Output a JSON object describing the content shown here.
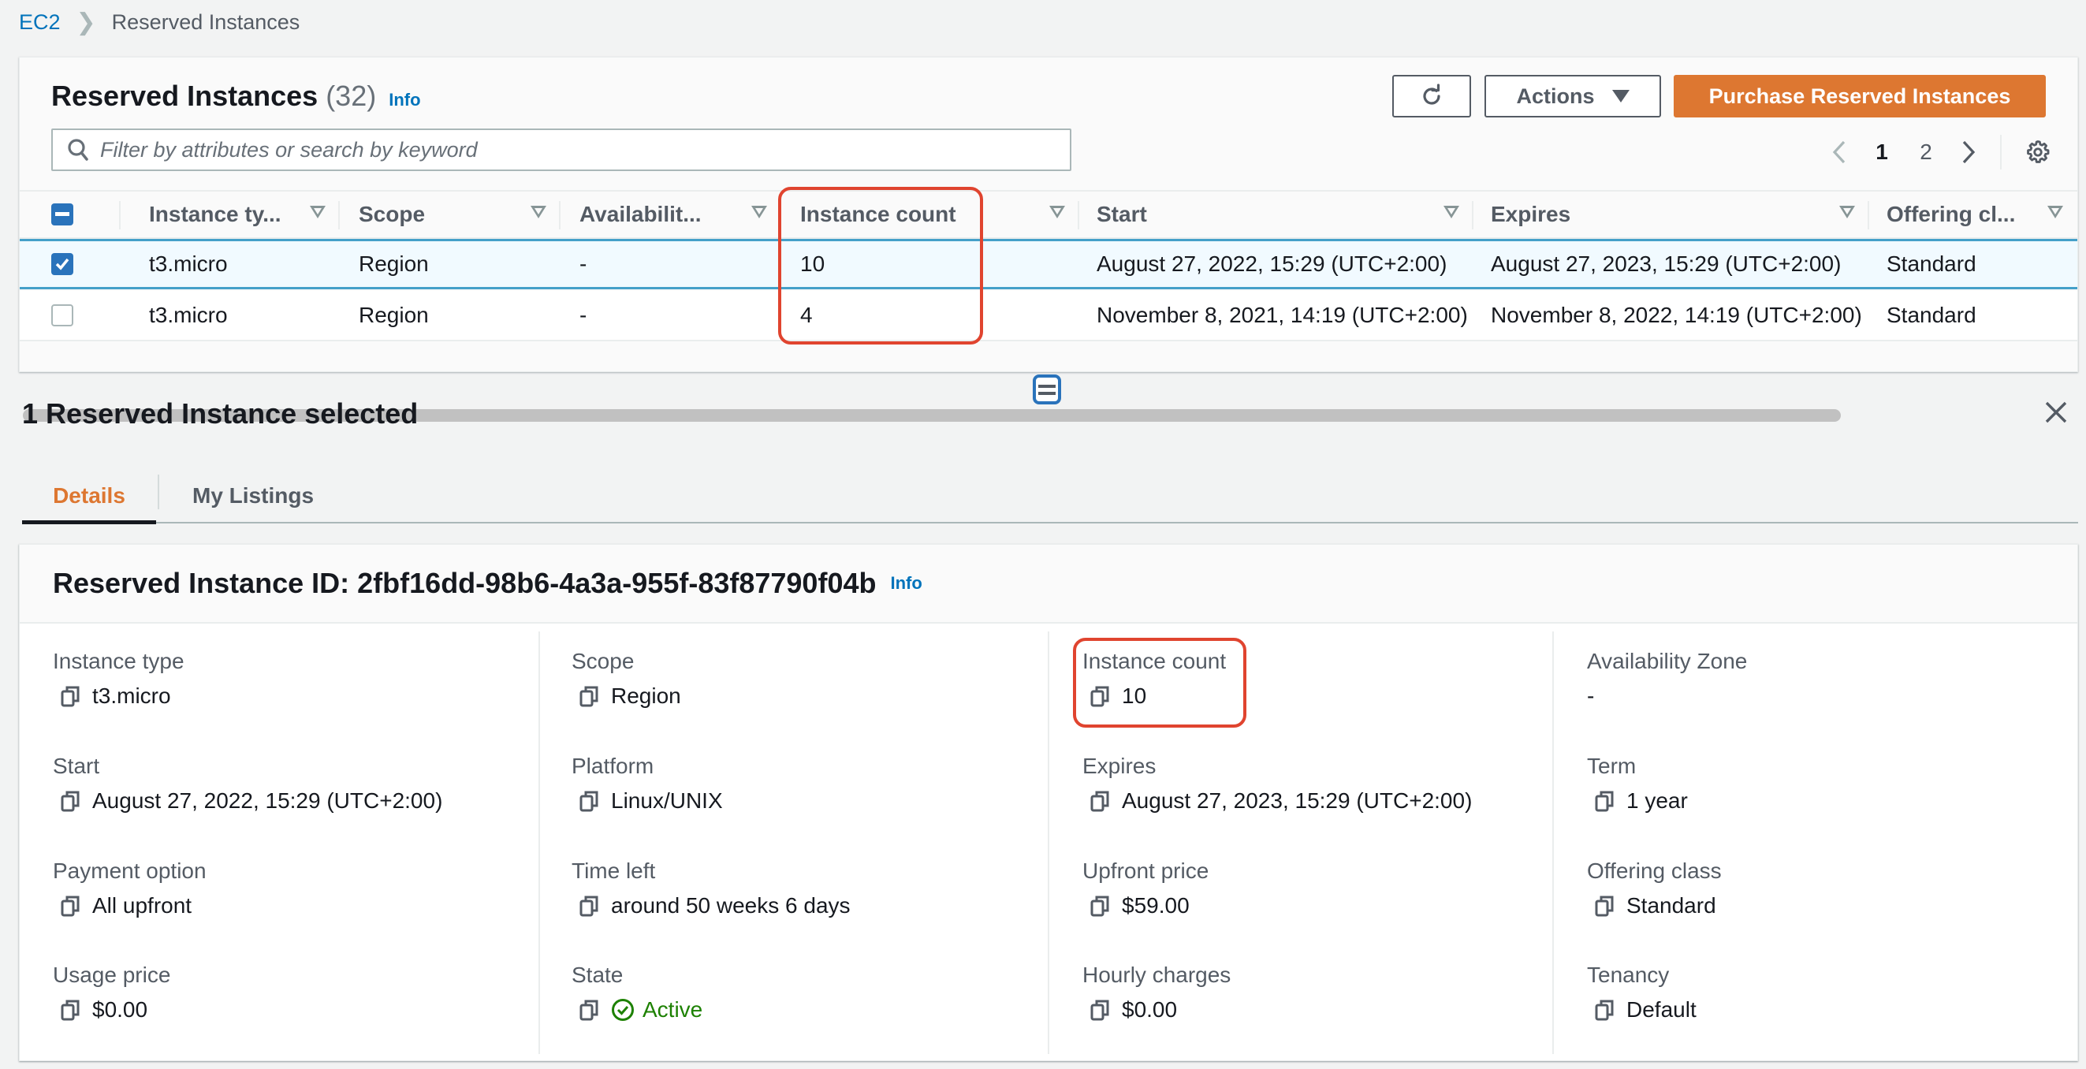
{
  "breadcrumb": {
    "root": "EC2",
    "current": "Reserved Instances"
  },
  "header": {
    "title": "Reserved Instances",
    "count": "(32)",
    "info": "Info",
    "refresh_icon": "refresh-icon",
    "actions_label": "Actions",
    "primary_label": "Purchase Reserved Instances"
  },
  "search": {
    "placeholder": "Filter by attributes or search by keyword",
    "value": ""
  },
  "pagination": {
    "pages": [
      "1",
      "2"
    ],
    "current": "1"
  },
  "table": {
    "columns": [
      "Instance ty...",
      "Scope",
      "Availabilit...",
      "Instance count",
      "Start",
      "Expires",
      "Offering cl..."
    ],
    "rows": [
      {
        "selected": true,
        "instance_type": "t3.micro",
        "scope": "Region",
        "availability_zone": "-",
        "instance_count": "10",
        "start": "August 27, 2022, 15:29 (UTC+2:00)",
        "expires": "August 27, 2023, 15:29 (UTC+2:00)",
        "offering_class": "Standard"
      },
      {
        "selected": false,
        "instance_type": "t3.micro",
        "scope": "Region",
        "availability_zone": "-",
        "instance_count": "4",
        "start": "November 8, 2021, 14:19 (UTC+2:00)",
        "expires": "November 8, 2022, 14:19 (UTC+2:00)",
        "offering_class": "Standard"
      }
    ]
  },
  "split_panel": {
    "title": "1 Reserved Instance selected",
    "tabs": [
      "Details",
      "My Listings"
    ],
    "active_tab": "Details"
  },
  "details": {
    "heading": "Reserved Instance ID: 2fbf16dd-98b6-4a3a-955f-83f87790f04b",
    "info": "Info",
    "fields": {
      "instance_type": {
        "label": "Instance type",
        "value": "t3.micro"
      },
      "scope": {
        "label": "Scope",
        "value": "Region"
      },
      "instance_count": {
        "label": "Instance count",
        "value": "10"
      },
      "availability_zone": {
        "label": "Availability Zone",
        "value": "-"
      },
      "start": {
        "label": "Start",
        "value": "August 27, 2022, 15:29 (UTC+2:00)"
      },
      "platform": {
        "label": "Platform",
        "value": "Linux/UNIX"
      },
      "expires": {
        "label": "Expires",
        "value": "August 27, 2023, 15:29 (UTC+2:00)"
      },
      "term": {
        "label": "Term",
        "value": "1 year"
      },
      "payment_option": {
        "label": "Payment option",
        "value": "All upfront"
      },
      "time_left": {
        "label": "Time left",
        "value": "around 50 weeks 6 days"
      },
      "upfront_price": {
        "label": "Upfront price",
        "value": "$59.00"
      },
      "offering_class": {
        "label": "Offering class",
        "value": "Standard"
      },
      "usage_price": {
        "label": "Usage price",
        "value": "$0.00"
      },
      "state": {
        "label": "State",
        "value": "Active"
      },
      "hourly_charges": {
        "label": "Hourly charges",
        "value": "$0.00"
      },
      "tenancy": {
        "label": "Tenancy",
        "value": "Default"
      }
    }
  },
  "colors": {
    "primary": "#dd7731",
    "link": "#0073bb",
    "selected_border": "#44a0c9",
    "checkbox": "#2a73bb",
    "success": "#1d8102",
    "annotation": "#e0442f"
  }
}
